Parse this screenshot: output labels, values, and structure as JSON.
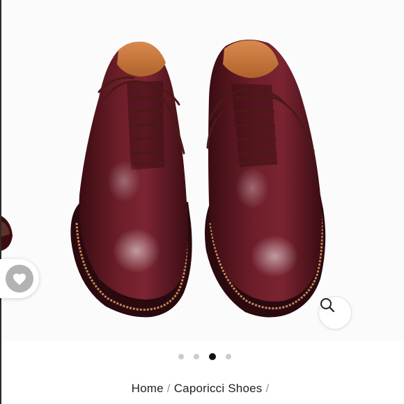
{
  "product_gallery": {
    "image_alt": "Burgundy wholecut oxford shoes with brown laces",
    "slides_count": 4,
    "active_slide_index": 2
  },
  "breadcrumb": {
    "items": [
      {
        "label": "Home"
      },
      {
        "label": "Caporicci Shoes"
      }
    ],
    "separator": "/"
  },
  "actions": {
    "wishlist_icon": "heart-icon",
    "zoom_icon": "search-icon"
  },
  "colors": {
    "leather": "#5a1620",
    "active_dot": "#111111",
    "inactive_dot": "#cccccc"
  }
}
